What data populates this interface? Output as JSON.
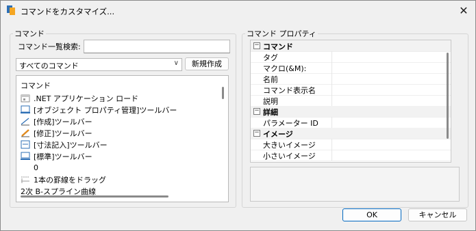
{
  "window": {
    "title": "コマンドをカスタマイズ..."
  },
  "left": {
    "group_label": "コマンド",
    "search_label": "コマンド一覧検索:",
    "search_value": "",
    "filter_value": "すべてのコマンド",
    "new_button": "新規作成",
    "list_header": "コマンド",
    "items": [
      {
        "label": ".NET アプリケーション ロード",
        "icon": "app-window-icon"
      },
      {
        "label": "[オブジェクト プロパティ管理]ツールバー",
        "icon": "toolbar-icon"
      },
      {
        "label": "[作成]ツールバー",
        "icon": "draw-line-icon"
      },
      {
        "label": "[修正]ツールバー",
        "icon": "pencil-icon"
      },
      {
        "label": "[寸法記入]ツールバー",
        "icon": "dimension-icon"
      },
      {
        "label": "[標準]ツールバー",
        "icon": "monitor-icon"
      },
      {
        "label": "0",
        "icon": ""
      },
      {
        "label": "1本の罫線をドラッグ",
        "icon": "ruler-drag-icon"
      },
      {
        "label": "2次 B-スプライン曲線",
        "icon": ""
      }
    ]
  },
  "right": {
    "group_label": "コマンド プロパティ",
    "categories": [
      {
        "name": "コマンド",
        "props": [
          "タグ",
          "マクロ(&M):",
          "名前",
          "コマンド表示名",
          "説明"
        ]
      },
      {
        "name": "詳細",
        "props": [
          "パラメーター ID"
        ]
      },
      {
        "name": "イメージ",
        "props": [
          "大きいイメージ",
          "小さいイメージ"
        ]
      }
    ],
    "collapse_glyph": "⊟"
  },
  "footer": {
    "ok": "OK",
    "cancel": "キャンセル"
  },
  "colors": {
    "ok_border": "#0067c0",
    "icon_blue": "#2d6fb5"
  }
}
